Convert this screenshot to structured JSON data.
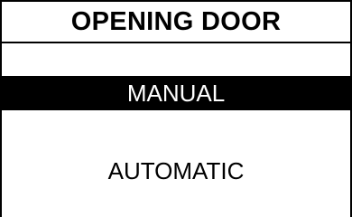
{
  "screen": {
    "title": "OPENING DOOR",
    "menu": {
      "items": [
        {
          "label": "MANUAL",
          "selected": true
        },
        {
          "label": "AUTOMATIC",
          "selected": false
        }
      ]
    },
    "colors": {
      "background": "#ffffff",
      "foreground": "#000000",
      "highlight_bg": "#000000",
      "highlight_fg": "#ffffff"
    }
  }
}
